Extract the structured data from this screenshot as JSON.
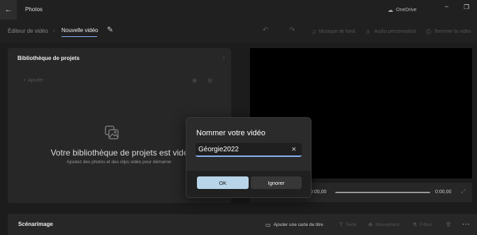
{
  "window": {
    "app_title": "Photos",
    "back_icon": "back-arrow-icon",
    "onedrive_label": "OneDrive",
    "onedrive_icon": "cloud-icon"
  },
  "toolbar": {
    "breadcrumb_root": "Éditeur de vidéo",
    "breadcrumb_current": "Nouvelle vidéo",
    "rename_icon": "pencil-icon",
    "undo_icon": "undo-icon",
    "redo_icon": "redo-icon",
    "background_music": "Musique de fond",
    "custom_audio": "Audio personnalisé",
    "finish_video": "Terminer la vidéo"
  },
  "library": {
    "title": "Bibliothèque de projets",
    "add_label": "Ajouter",
    "empty_title": "Votre bibliothèque de projets est vide",
    "empty_subtitle": "Ajoutez des photos et des clips vidéo pour démarrer."
  },
  "player": {
    "time_start": "0:00,00",
    "time_end": "0:00,00",
    "progress": 0
  },
  "storyboard": {
    "title": "Scénarimage",
    "add_title_card": "Ajouter une carte de titre",
    "text": "Texte",
    "motion": "Mouvement",
    "filters": "Filtres",
    "more": "..."
  },
  "dialog": {
    "title": "Nommer votre vidéo",
    "input_value": "Géorgie2022",
    "ok_label": "OK",
    "ignore_label": "Ignorer"
  },
  "colors": {
    "accent": "#8ab4f8",
    "ok_button": "#b8d4e8",
    "background": "#1c1c1c"
  }
}
